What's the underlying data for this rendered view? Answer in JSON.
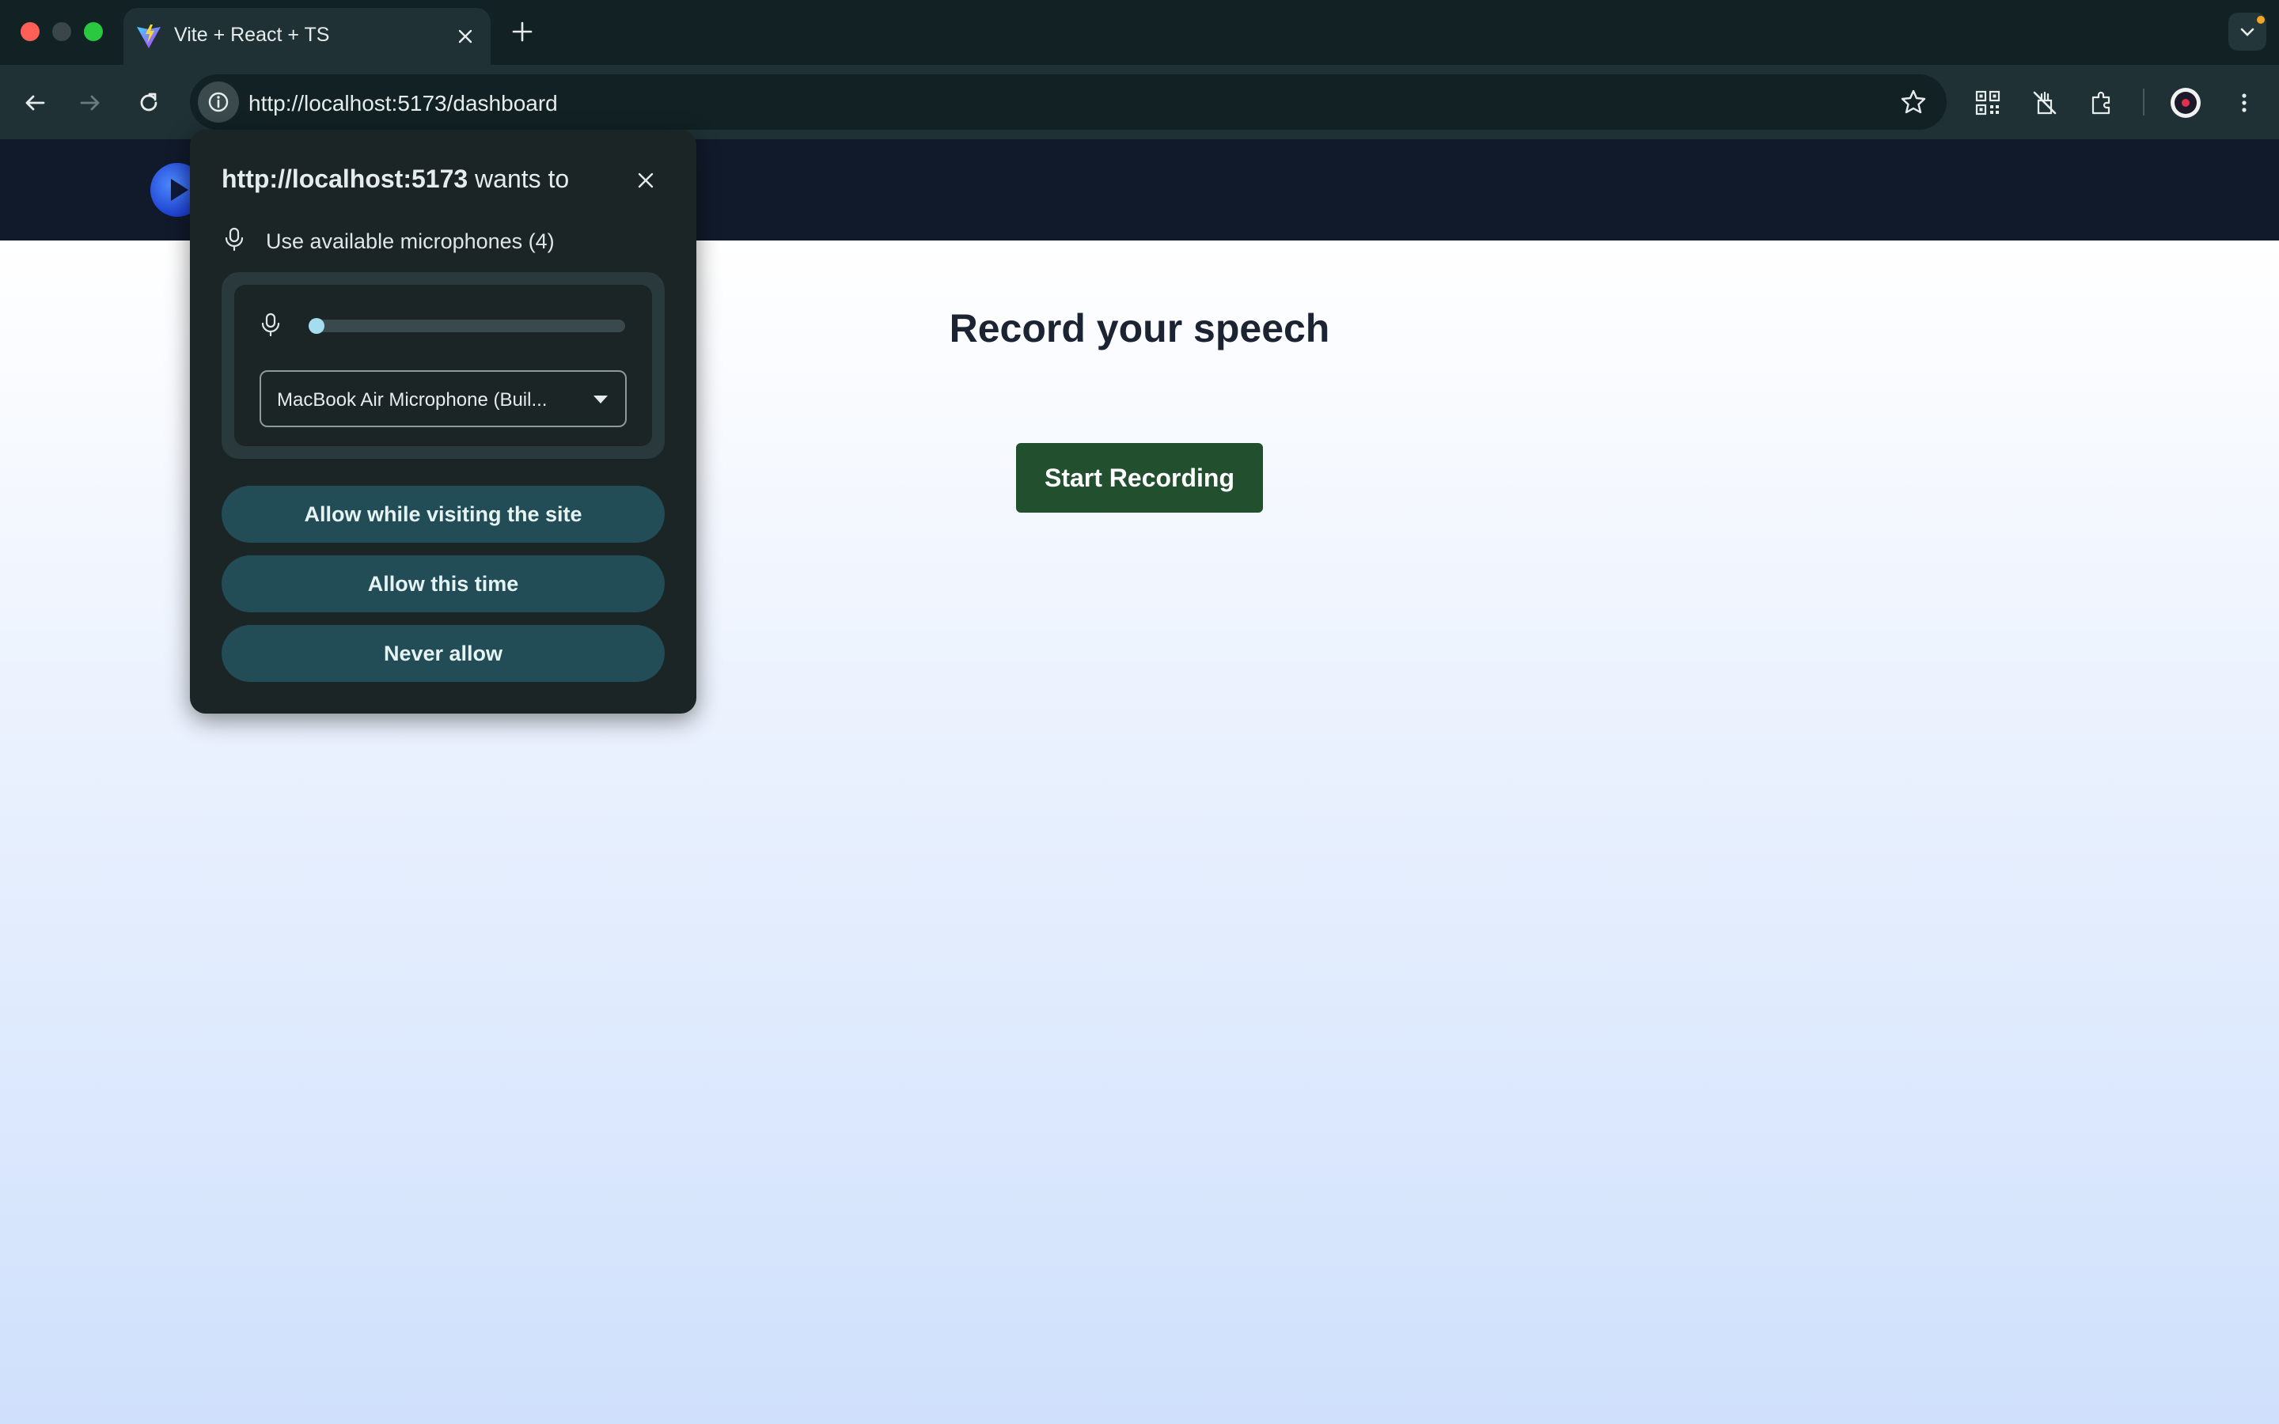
{
  "browser": {
    "tab": {
      "title": "Vite + React + TS",
      "favicon": "vite-logo-icon"
    },
    "url": "http://localhost:5173/dashboard",
    "toolbar_icons": [
      "back-arrow-icon",
      "forward-arrow-icon",
      "reload-icon",
      "site-info-icon",
      "bookmark-star-icon",
      "qr-code-icon",
      "hide-ads-icon",
      "extensions-puzzle-icon",
      "profile-avatar-icon",
      "kebab-menu-icon"
    ],
    "window_controls": [
      "close",
      "minimize",
      "maximize"
    ]
  },
  "permission_popup": {
    "title_host": "http://localhost:5173",
    "title_suffix": " wants to",
    "permission_text": "Use available microphones (4)",
    "level_fraction": 0.04,
    "selected_device": "MacBook Air Microphone (Buil...",
    "buttons": {
      "allow_site": "Allow while visiting the site",
      "allow_once": "Allow this time",
      "never": "Never allow"
    }
  },
  "page": {
    "title": "Record your speech",
    "record_button": "Start Recording"
  },
  "colors": {
    "record_button": "#22502f",
    "popup_button": "#224c56",
    "header": "#111a2b"
  }
}
